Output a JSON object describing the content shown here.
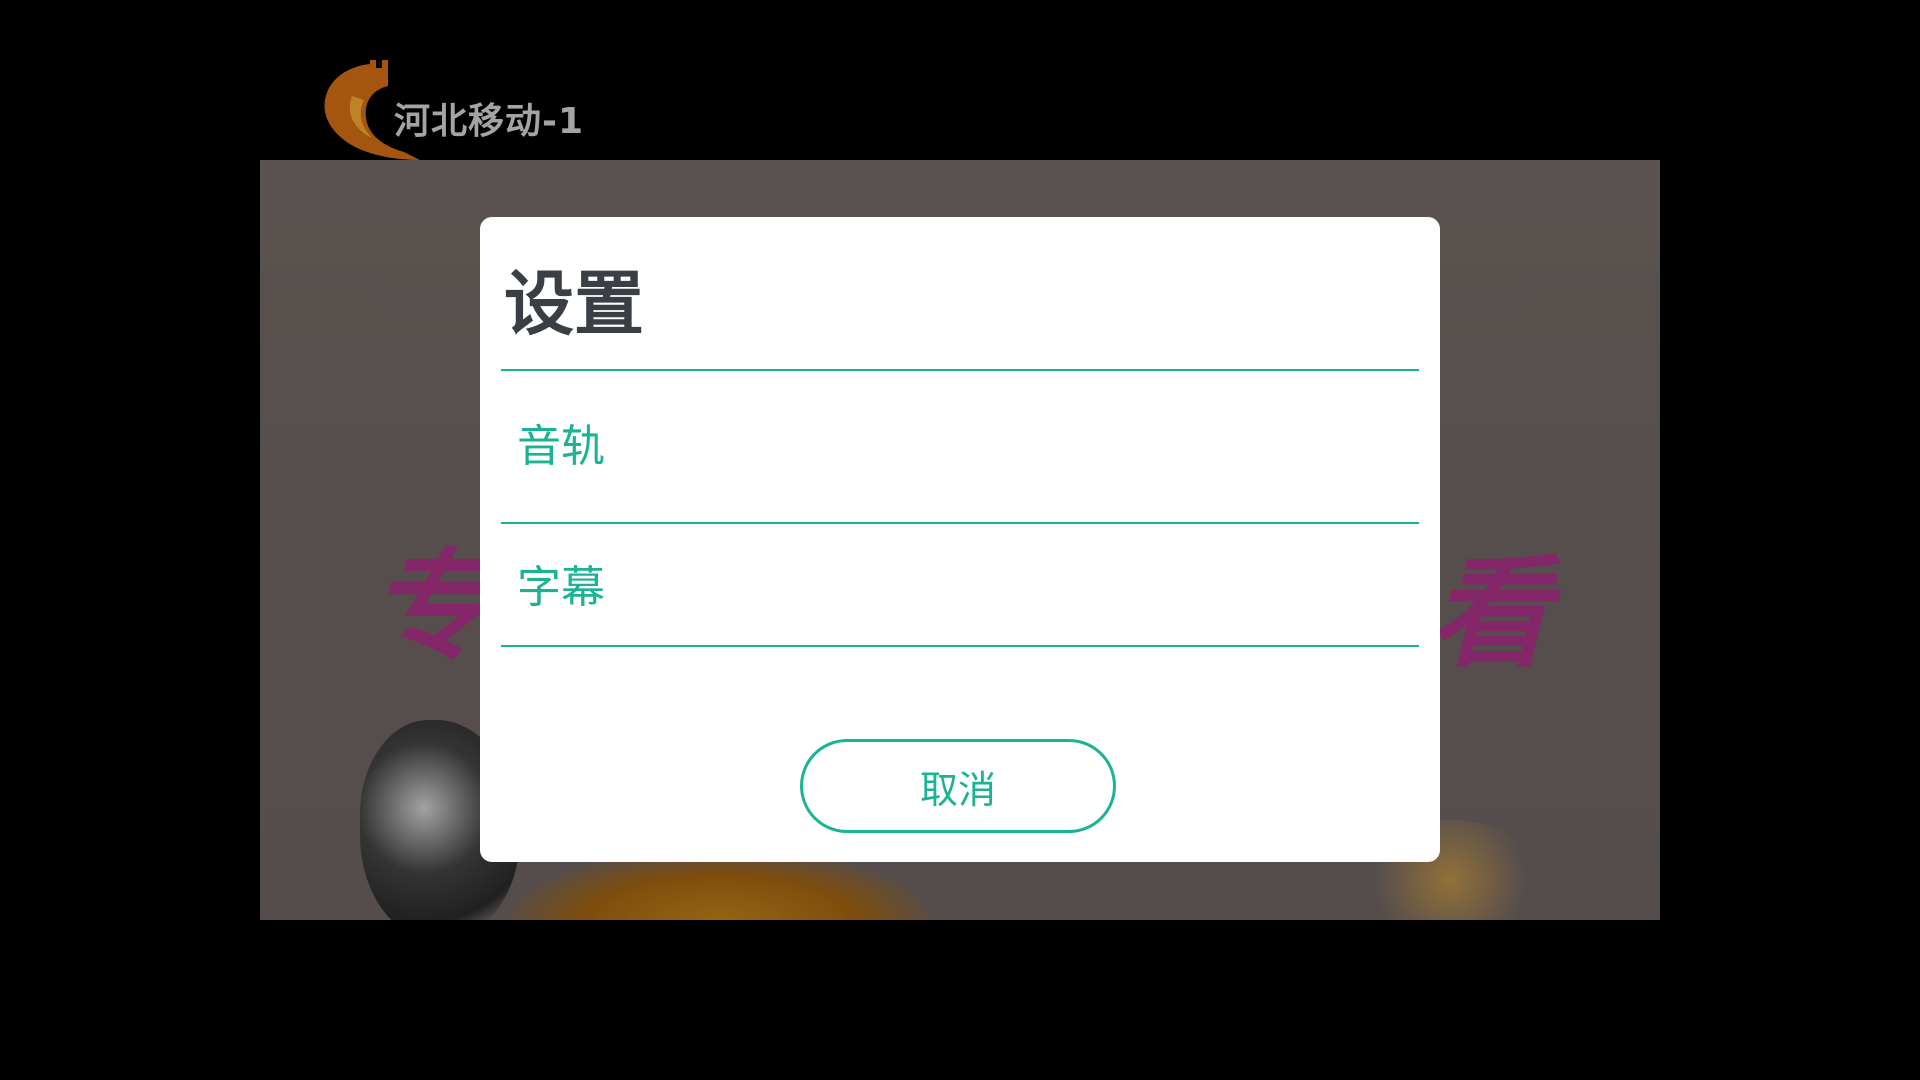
{
  "player": {
    "channel_name": "河北移动-1",
    "promo_left": "专",
    "promo_right": "看"
  },
  "dialog": {
    "title": "设置",
    "items": [
      {
        "label": "音轨"
      },
      {
        "label": "字幕"
      }
    ],
    "cancel_label": "取消"
  },
  "colors": {
    "accent": "#1ab394",
    "title_text": "#3a3f45",
    "dialog_bg": "#ffffff",
    "screen_bg": "#000000"
  }
}
